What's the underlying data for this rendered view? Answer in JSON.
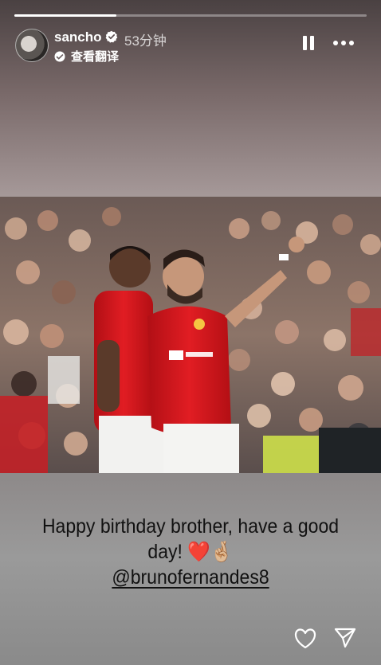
{
  "progress": {
    "fraction": 0.29,
    "segment_index": 1,
    "segment_count": 2
  },
  "header": {
    "username": "sancho",
    "time": "53分钟",
    "translate_label": "查看翻译",
    "verified": true
  },
  "icons": {
    "verified": "verified-badge-icon",
    "translate": "translate-icon",
    "pause": "pause-icon",
    "more": "more-icon",
    "heart": "heart-icon",
    "share": "send-icon"
  },
  "caption": {
    "line1": "Happy birthday brother, have a good",
    "line2": "day! ❤️🤞🏼",
    "mention": "@brunofernandes8"
  },
  "colors": {
    "jersey_red": "#d4151b",
    "caption_text": "#111111"
  }
}
